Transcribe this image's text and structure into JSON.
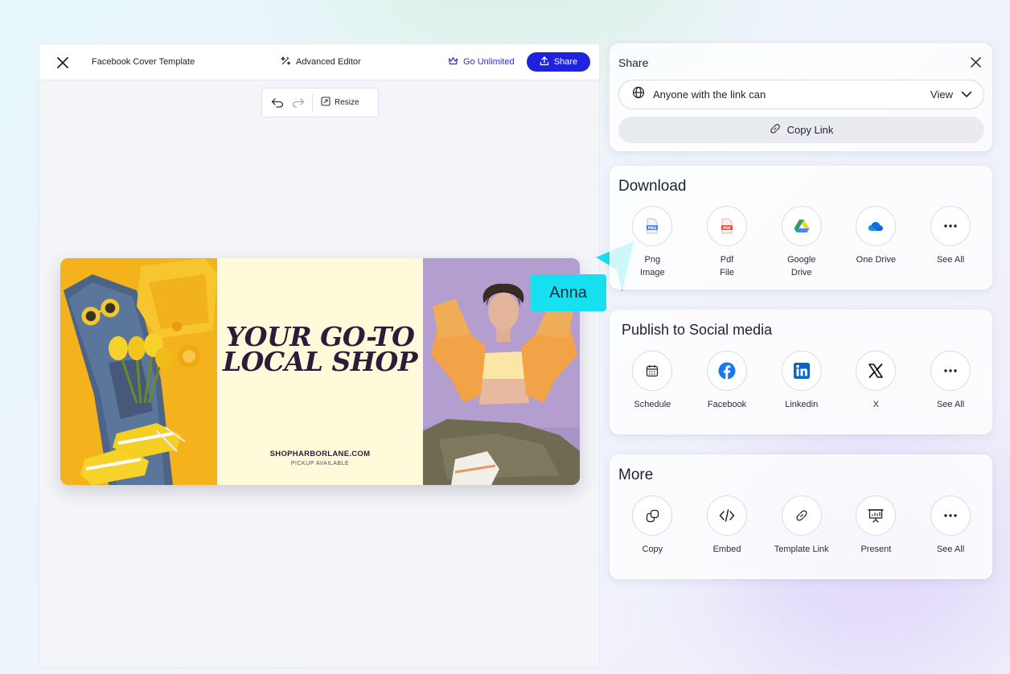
{
  "editor": {
    "doc_title": "Facebook Cover Template",
    "advanced_editor": "Advanced Editor",
    "go_unlimited": "Go Unlimited",
    "share_button": "Share",
    "resize": "Resize"
  },
  "banner": {
    "headline_line1": "YOUR GO-TO",
    "headline_line2": "LOCAL SHOP",
    "website": "SHOPHARBORLANE.COM",
    "pickup": "PICKUP AVAILABLE"
  },
  "collaborator": {
    "name": "Anna",
    "color": "#17e0f0"
  },
  "share_panel": {
    "title": "Share",
    "permission_text": "Anyone with the link can",
    "permission_value": "View",
    "copy_link": "Copy Link"
  },
  "download": {
    "title": "Download",
    "items": [
      {
        "label": "Png\nImage",
        "icon": "png-file-icon"
      },
      {
        "label": "Pdf\nFile",
        "icon": "pdf-file-icon"
      },
      {
        "label": "Google\nDrive",
        "icon": "google-drive-icon"
      },
      {
        "label": "One Drive",
        "icon": "onedrive-icon"
      },
      {
        "label": "See All",
        "icon": "more-icon"
      }
    ]
  },
  "publish": {
    "title": "Publish to Social media",
    "items": [
      {
        "label": "Schedule",
        "icon": "calendar-icon"
      },
      {
        "label": "Facebook",
        "icon": "facebook-icon"
      },
      {
        "label": "Linkedin",
        "icon": "linkedin-icon"
      },
      {
        "label": "X",
        "icon": "x-icon"
      },
      {
        "label": "See All",
        "icon": "more-icon"
      }
    ]
  },
  "more": {
    "title": "More",
    "items": [
      {
        "label": "Copy",
        "icon": "copy-icon"
      },
      {
        "label": "Embed",
        "icon": "embed-icon"
      },
      {
        "label": "Template Link",
        "icon": "link-icon"
      },
      {
        "label": "Present",
        "icon": "present-icon"
      },
      {
        "label": "See All",
        "icon": "more-icon"
      }
    ]
  },
  "colors": {
    "primary": "#1f23e0",
    "facebook": "#1877f2",
    "linkedin": "#0a66c2"
  }
}
